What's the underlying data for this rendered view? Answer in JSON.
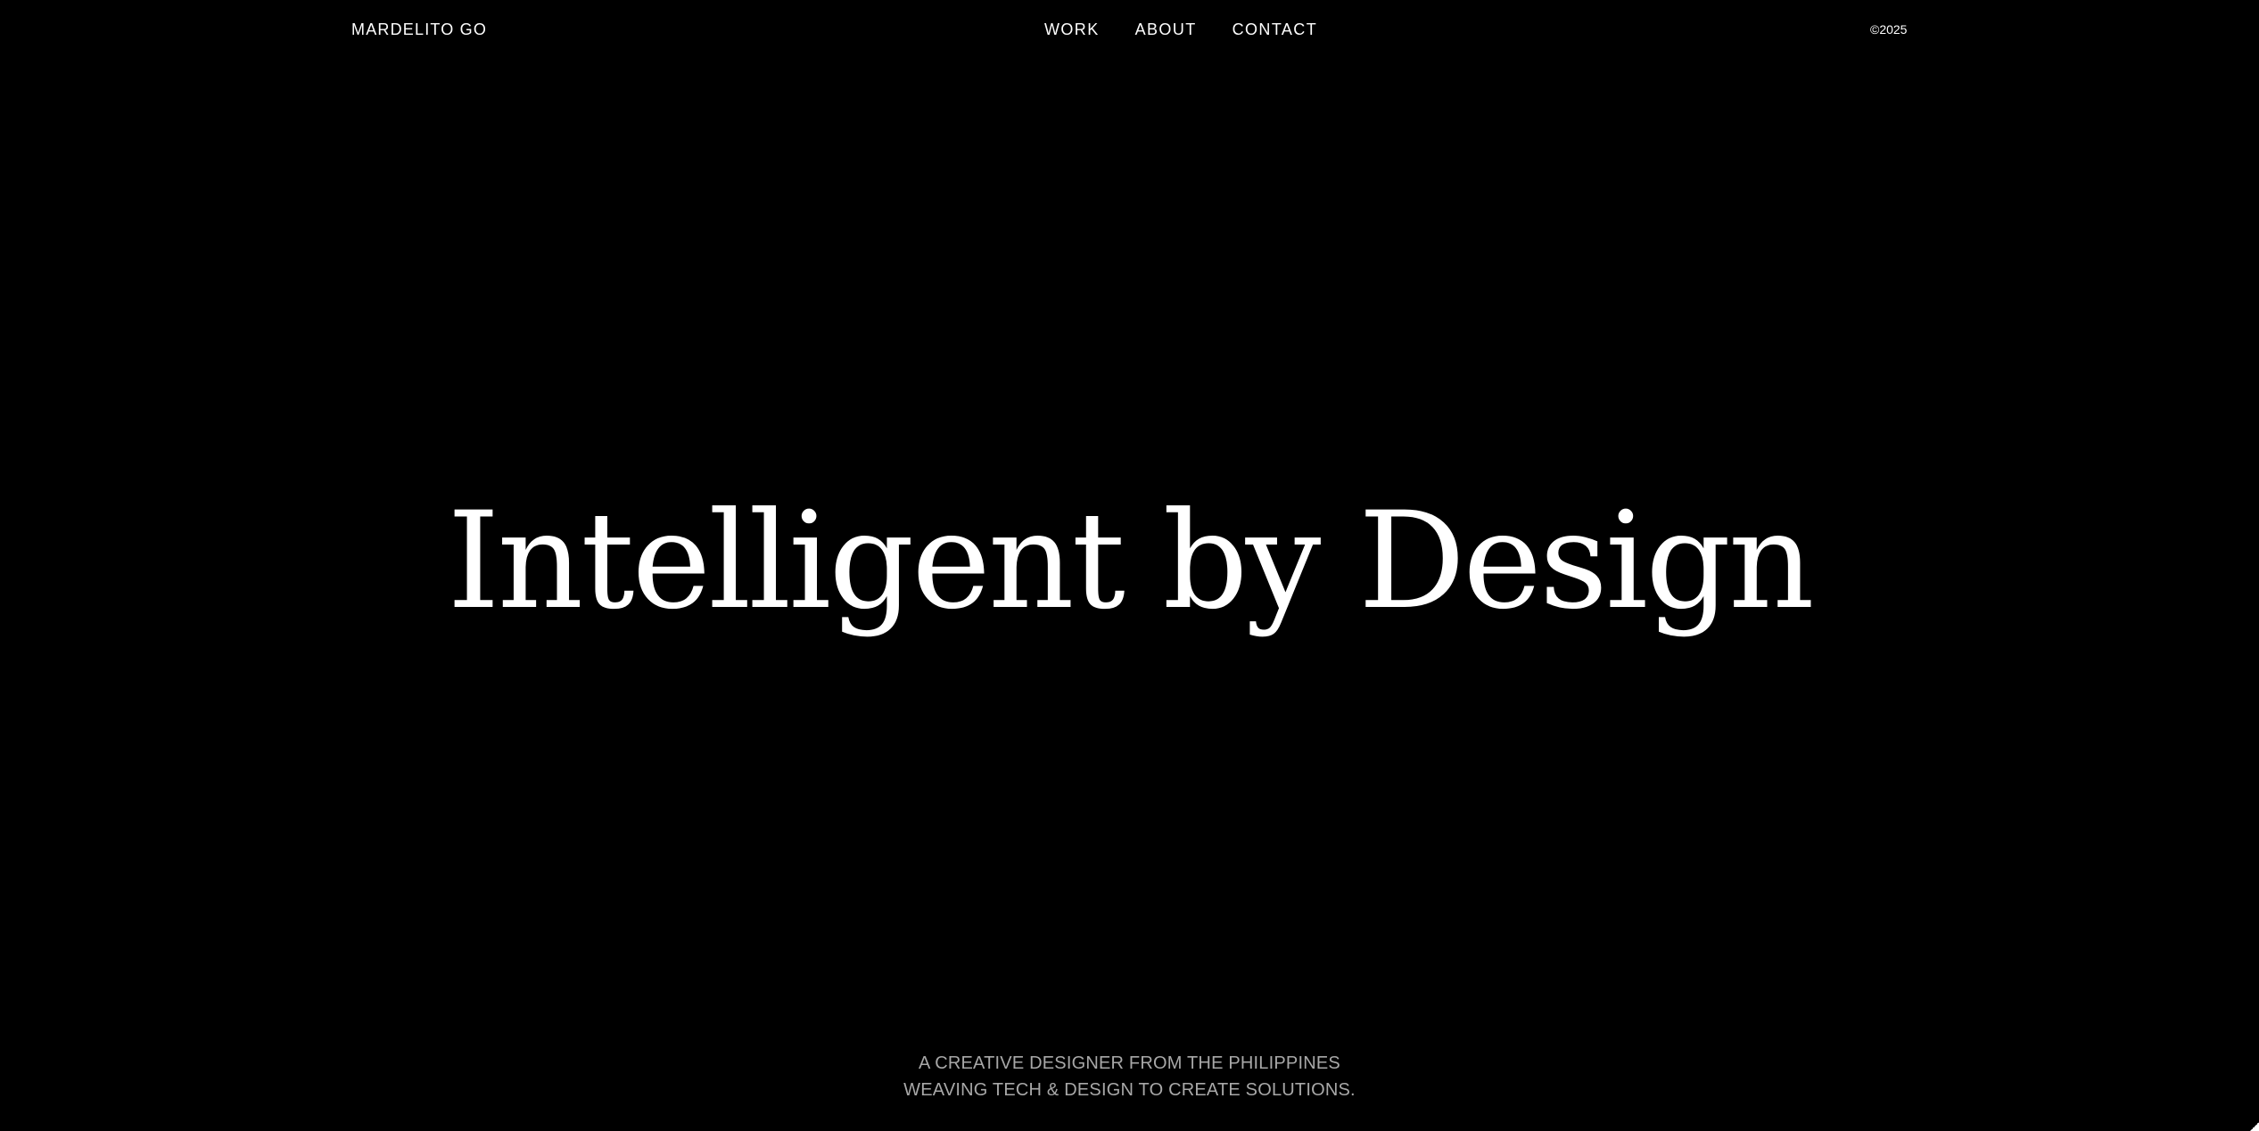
{
  "header": {
    "brand": "MARDELITO GO",
    "nav": [
      {
        "label": "WORK"
      },
      {
        "label": "ABOUT"
      },
      {
        "label": "CONTACT"
      }
    ],
    "copyright": "©2025"
  },
  "hero": {
    "title": "Intelligent by Design"
  },
  "tagline": {
    "line1": "A CREATIVE DESIGNER FROM THE PHILIPPINES",
    "line2": "WEAVING TECH & DESIGN TO CREATE SOLUTIONS."
  },
  "colors": {
    "background": "#000000",
    "text": "#ffffff",
    "muted": "#a8a8a8"
  }
}
